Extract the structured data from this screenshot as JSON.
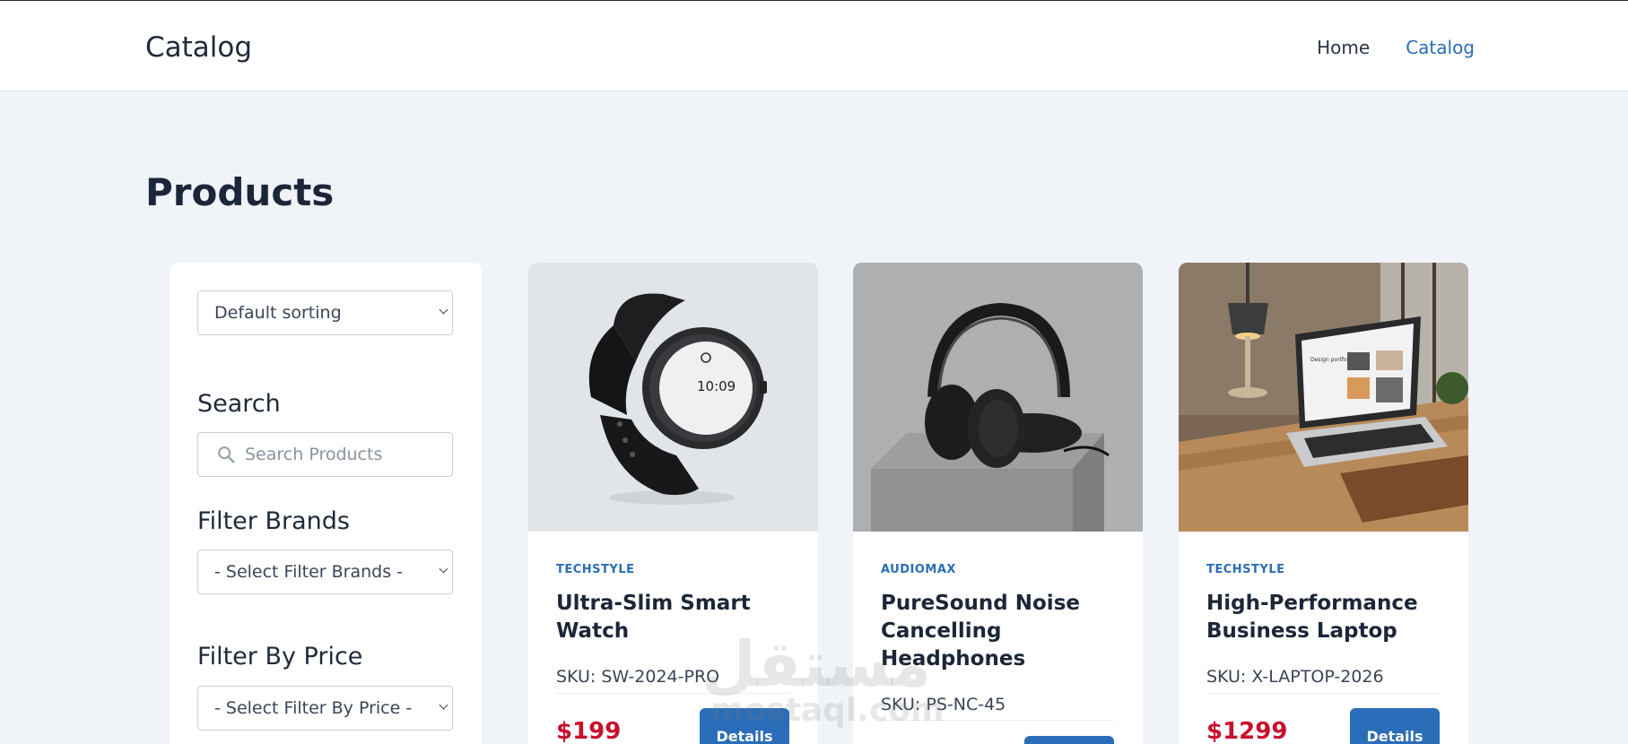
{
  "header": {
    "brand": "Catalog",
    "nav": [
      {
        "label": "Home",
        "active": false
      },
      {
        "label": "Catalog",
        "active": true
      }
    ]
  },
  "page_title": "Products",
  "sidebar": {
    "sort_select": {
      "value": "Default sorting"
    },
    "search": {
      "heading": "Search",
      "placeholder": "Search Products"
    },
    "brands": {
      "heading": "Filter Brands",
      "value": "- Select Filter Brands -"
    },
    "price": {
      "heading": "Filter By Price",
      "value": "- Select Filter By Price -"
    }
  },
  "products": [
    {
      "brand": "TECHSTYLE",
      "title": "Ultra-Slim Smart Watch",
      "sku": "SKU: SW-2024-PRO",
      "price": "$199",
      "button": "Details",
      "watch_time": "10:09"
    },
    {
      "brand": "AUDIOMAX",
      "title": "PureSound Noise Cancelling Headphones",
      "sku": "SKU: PS-NC-45",
      "price": "",
      "button": ""
    },
    {
      "brand": "TECHSTYLE",
      "title": "High-Performance Business Laptop",
      "sku": "SKU: X-LAPTOP-2026",
      "price": "$1299",
      "button": "Details",
      "screen_text": "Design portfolio"
    }
  ],
  "watermark": {
    "arabic": "مستقل",
    "latin": "mostaql.com"
  },
  "colors": {
    "accent": "#2a6db8",
    "price": "#c8102e",
    "background": "#f0f3f8"
  }
}
